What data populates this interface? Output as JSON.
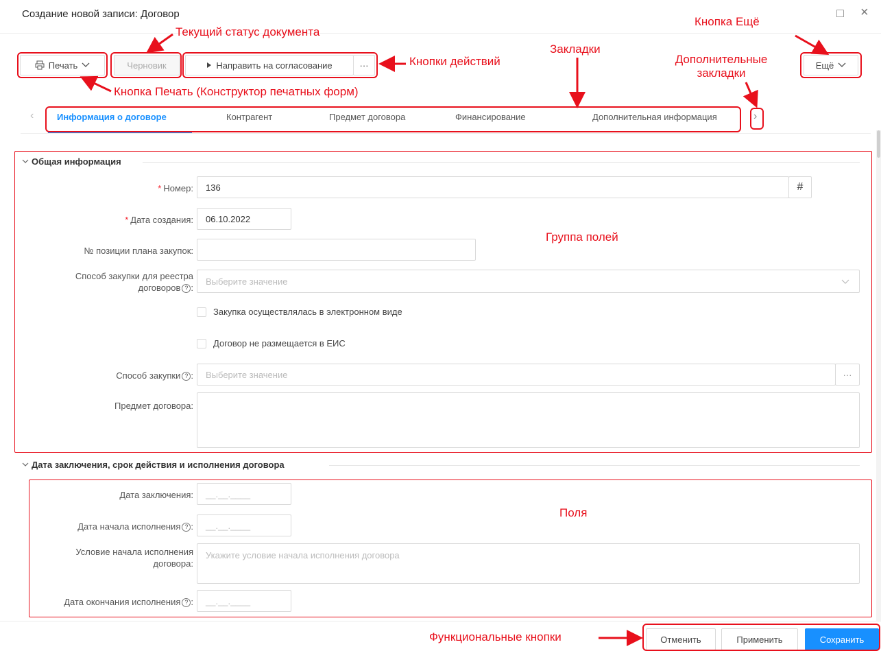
{
  "window": {
    "title": "Создание новой записи: Договор",
    "max_icon": "□",
    "close_icon": "×"
  },
  "toolbar": {
    "print_label": "Печать",
    "status_label": "Черновик",
    "send_label": "Направить на согласование",
    "more_dots": "···",
    "more_label": "Ещё"
  },
  "tabs": [
    {
      "label": "Информация о договоре",
      "active": true
    },
    {
      "label": "Контрагент",
      "active": false
    },
    {
      "label": "Предмет договора",
      "active": false
    },
    {
      "label": "Финансирование",
      "active": false
    },
    {
      "label": "Дополнительная информация",
      "active": false
    }
  ],
  "tab_nav": {
    "prev": "‹",
    "next": "›"
  },
  "section_general": {
    "title": "Общая информация",
    "number_label": "Номер:",
    "number_value": "136",
    "created_label": "Дата создания:",
    "created_value": "06.10.2022",
    "plan_position_label": "№ позиции плана закупок:",
    "method_registry_label_1": "Способ закупки для реестра",
    "method_registry_label_2": "договоров",
    "method_registry_placeholder": "Выберите значение",
    "checkbox_electronic": "Закупка осуществлялась в электронном виде",
    "checkbox_eis": "Договор не размещается в ЕИС",
    "purchase_method_label": "Способ закупки",
    "purchase_method_placeholder": "Выберите значение",
    "subject_label": "Предмет договора:",
    "hash_icon": "#",
    "dots": "···"
  },
  "section_dates": {
    "title": "Дата заключения, срок действия и исполнения договора",
    "conclusion_label": "Дата заключения:",
    "start_label": "Дата начала исполнения",
    "condition_label_1": "Условие начала исполнения",
    "condition_label_2": "договора:",
    "condition_placeholder": "Укажите условие начала исполнения договора",
    "end_label": "Дата окончания исполнения",
    "date_mask": "__.__.____"
  },
  "footer": {
    "cancel": "Отменить",
    "apply": "Применить",
    "save": "Сохранить"
  },
  "annotations": {
    "status": "Текущий статус документа",
    "more": "Кнопка Ещё",
    "actions": "Кнопки действий",
    "tabs": "Закладки",
    "extra_tabs_1": "Дополнительные",
    "extra_tabs_2": "закладки",
    "print": "Кнопка Печать (Конструктор печатных форм)",
    "field_group": "Группа полей",
    "fields": "Поля",
    "functional": "Функциональные кнопки"
  },
  "colors": {
    "accent": "#1890ff",
    "annotation": "#e8101c",
    "required": "#f5222d"
  }
}
